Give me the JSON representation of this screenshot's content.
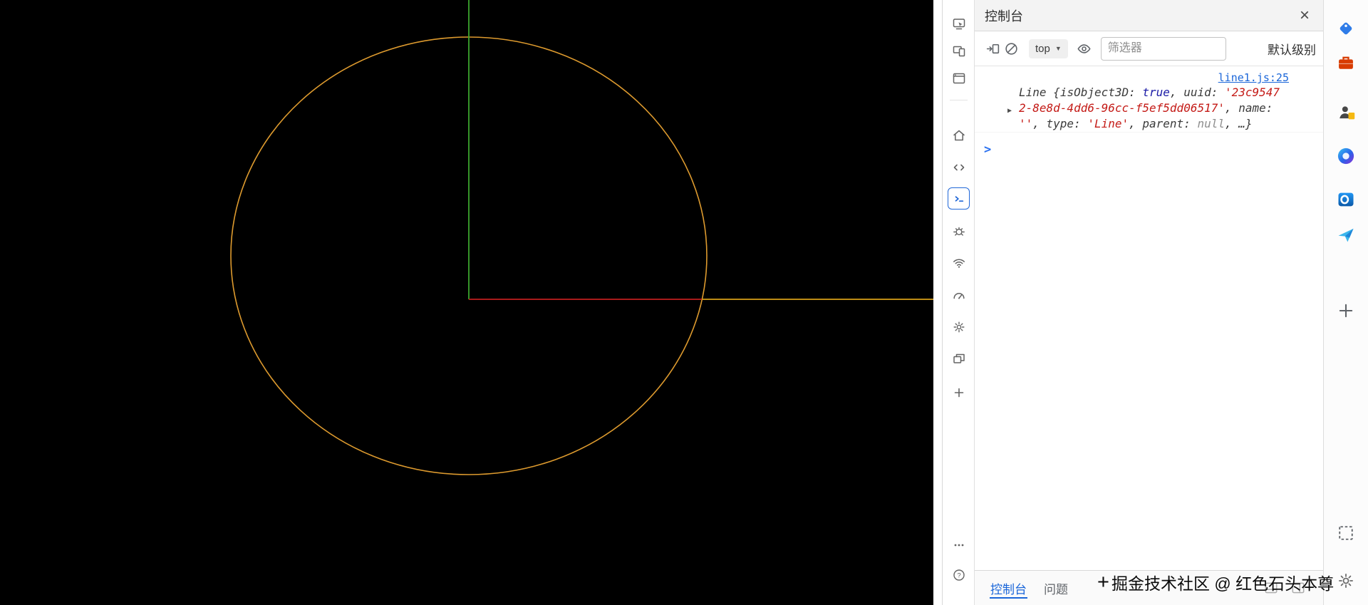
{
  "scene": {
    "circle_color": "#dd9a2e",
    "axis_up_color": "#3da52e",
    "axis_down_color_top": "#2b50d0",
    "axis_down_color_bottom": "#55a0ec",
    "axis_right_color": "#c01f1f",
    "line_right_color": "#d8a018",
    "background": "#000000"
  },
  "activity_bar": {
    "selected": "console",
    "icons": [
      "inspect",
      "device-emulation",
      "browser-tab",
      "home",
      "elements",
      "console",
      "debug",
      "network",
      "performance",
      "settings",
      "application",
      "more-tools",
      "more-options",
      "help"
    ]
  },
  "console_panel": {
    "title": "控制台",
    "close_glyph": "×",
    "toolbar": {
      "context_selector": "top",
      "caret_glyph": "▼",
      "filter_placeholder": "筛选器",
      "log_level": "默认级别"
    },
    "log": {
      "source_link": "line1.js:25",
      "expand_glyph": "▶",
      "seg": {
        "class_name": "Line ",
        "brace": "{",
        "p1_key": "isObject3D: ",
        "p1_val": "true",
        "sep1": ", ",
        "p2_key": "uuid: ",
        "p2_val_a": "'23c9547",
        "p2_val_b": "2-8e8d-4dd6-96cc-f5ef5dd06517'",
        "sep2": ", ",
        "p3_key": "name:",
        "p3_val": "''",
        "sep3": ", ",
        "p4_key": "type: ",
        "p4_val": "'Line'",
        "sep4": ", ",
        "p5_key": "parent: ",
        "p5_val": "null",
        "tail": ", …}"
      }
    },
    "prompt_glyph": ">",
    "tabs": [
      {
        "label": "控制台",
        "active": true
      },
      {
        "label": "问题",
        "active": false
      }
    ],
    "colors": {
      "accent_blue": "#1a66d9",
      "string_red": "#c41a16",
      "boolean_blue": "#1a1aa6",
      "null_gray": "#8e8e8e"
    }
  },
  "edge_sidebar": {
    "icons": [
      "shopping-tag",
      "office-briefcase",
      "contacts",
      "copilot",
      "outlook",
      "drop-plane",
      "add",
      "screenshot",
      "gear"
    ]
  },
  "watermark": {
    "plus": "+",
    "text": "掘金技术社区 @ 红色石头本尊"
  }
}
